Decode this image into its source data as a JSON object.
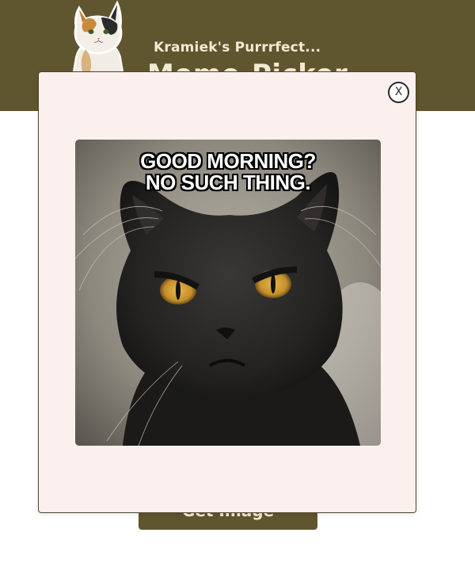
{
  "header": {
    "subtitle": "Kramiek's Purrrfect...",
    "title": "Meme-Picker"
  },
  "main": {
    "pick_button_label": "Get Image"
  },
  "modal": {
    "close_label": "X",
    "meme": {
      "caption_line1": "GOOD MORNING?",
      "caption_line2": "NO SUCH THING."
    }
  },
  "colors": {
    "header_bg": "#5f552f",
    "header_text": "#f3ead3",
    "modal_bg": "#fbf0ee",
    "modal_border": "#4c4328"
  }
}
